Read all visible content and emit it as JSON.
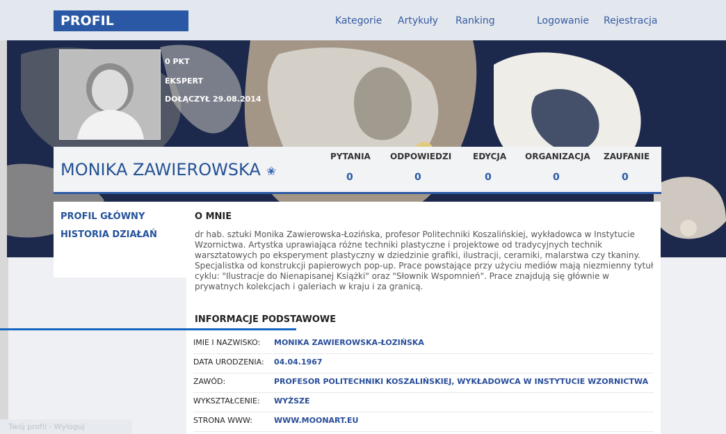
{
  "header": {
    "logo": "PROFIL",
    "nav": [
      "Kategorie",
      "Artykuły",
      "Ranking",
      "Logowanie",
      "Rejestracja"
    ]
  },
  "profile": {
    "points": "0 PKT",
    "level": "EKSPERT",
    "joined": "DOŁĄCZYŁ 29.08.2014",
    "name": "MONIKA ZAWIEROWSKA",
    "star_icon": "star-icon",
    "stats": [
      {
        "label": "PYTANIA",
        "value": "0"
      },
      {
        "label": "ODPOWIEDZI",
        "value": "0"
      },
      {
        "label": "EDYCJA",
        "value": "0"
      },
      {
        "label": "ORGANIZACJA",
        "value": "0"
      },
      {
        "label": "ZAUFANIE",
        "value": "0"
      }
    ]
  },
  "sidebar": {
    "items": [
      "PROFIL GŁÓWNY",
      "HISTORIA DZIAŁAŃ"
    ]
  },
  "about": {
    "title": "O MNIE",
    "text": "dr hab. sztuki Monika Zawierowska-Łozińska, profesor Politechniki Koszalińskiej, wykładowca w Instytucie Wzornictwa. Artystka uprawiająca różne techniki plastyczne i projektowe od tradycyjnych technik warsztatowych po eksperyment plastyczny w dziedzinie grafiki, ilustracji, ceramiki, malarstwa czy tkaniny. Specjalistka od konstrukcji papierowych pop-up. Prace powstające przy użyciu mediów mają niezmienny tytuł cyklu: \"Ilustracje do Nienapisanej Książki\" oraz \"Słownik Wspomnień\". Prace znajdują się głównie w prywatnych kolekcjach i galeriach w kraju i za granicą."
  },
  "info": {
    "title": "INFORMACJE PODSTAWOWE",
    "rows": [
      {
        "label": "IMIE I NAZWISKO:",
        "value": "MONIKA ZAWIEROWSKA-ŁOZIŃSKA"
      },
      {
        "label": "DATA URODZENIA:",
        "value": "04.04.1967"
      },
      {
        "label": "ZAWÓD:",
        "value": "PROFESOR POLITECHNIKI KOSZALIŃSKIEJ, WYKŁADOWCA W INSTYTUCIE WZORNICTWA"
      },
      {
        "label": "WYKSZTAŁCENIE:",
        "value": "WYŻSZE"
      },
      {
        "label": "STRONA WWW:",
        "value": "WWW.MOONART.EU"
      }
    ]
  },
  "footer_hint": "Twój profil · Wyloguj"
}
